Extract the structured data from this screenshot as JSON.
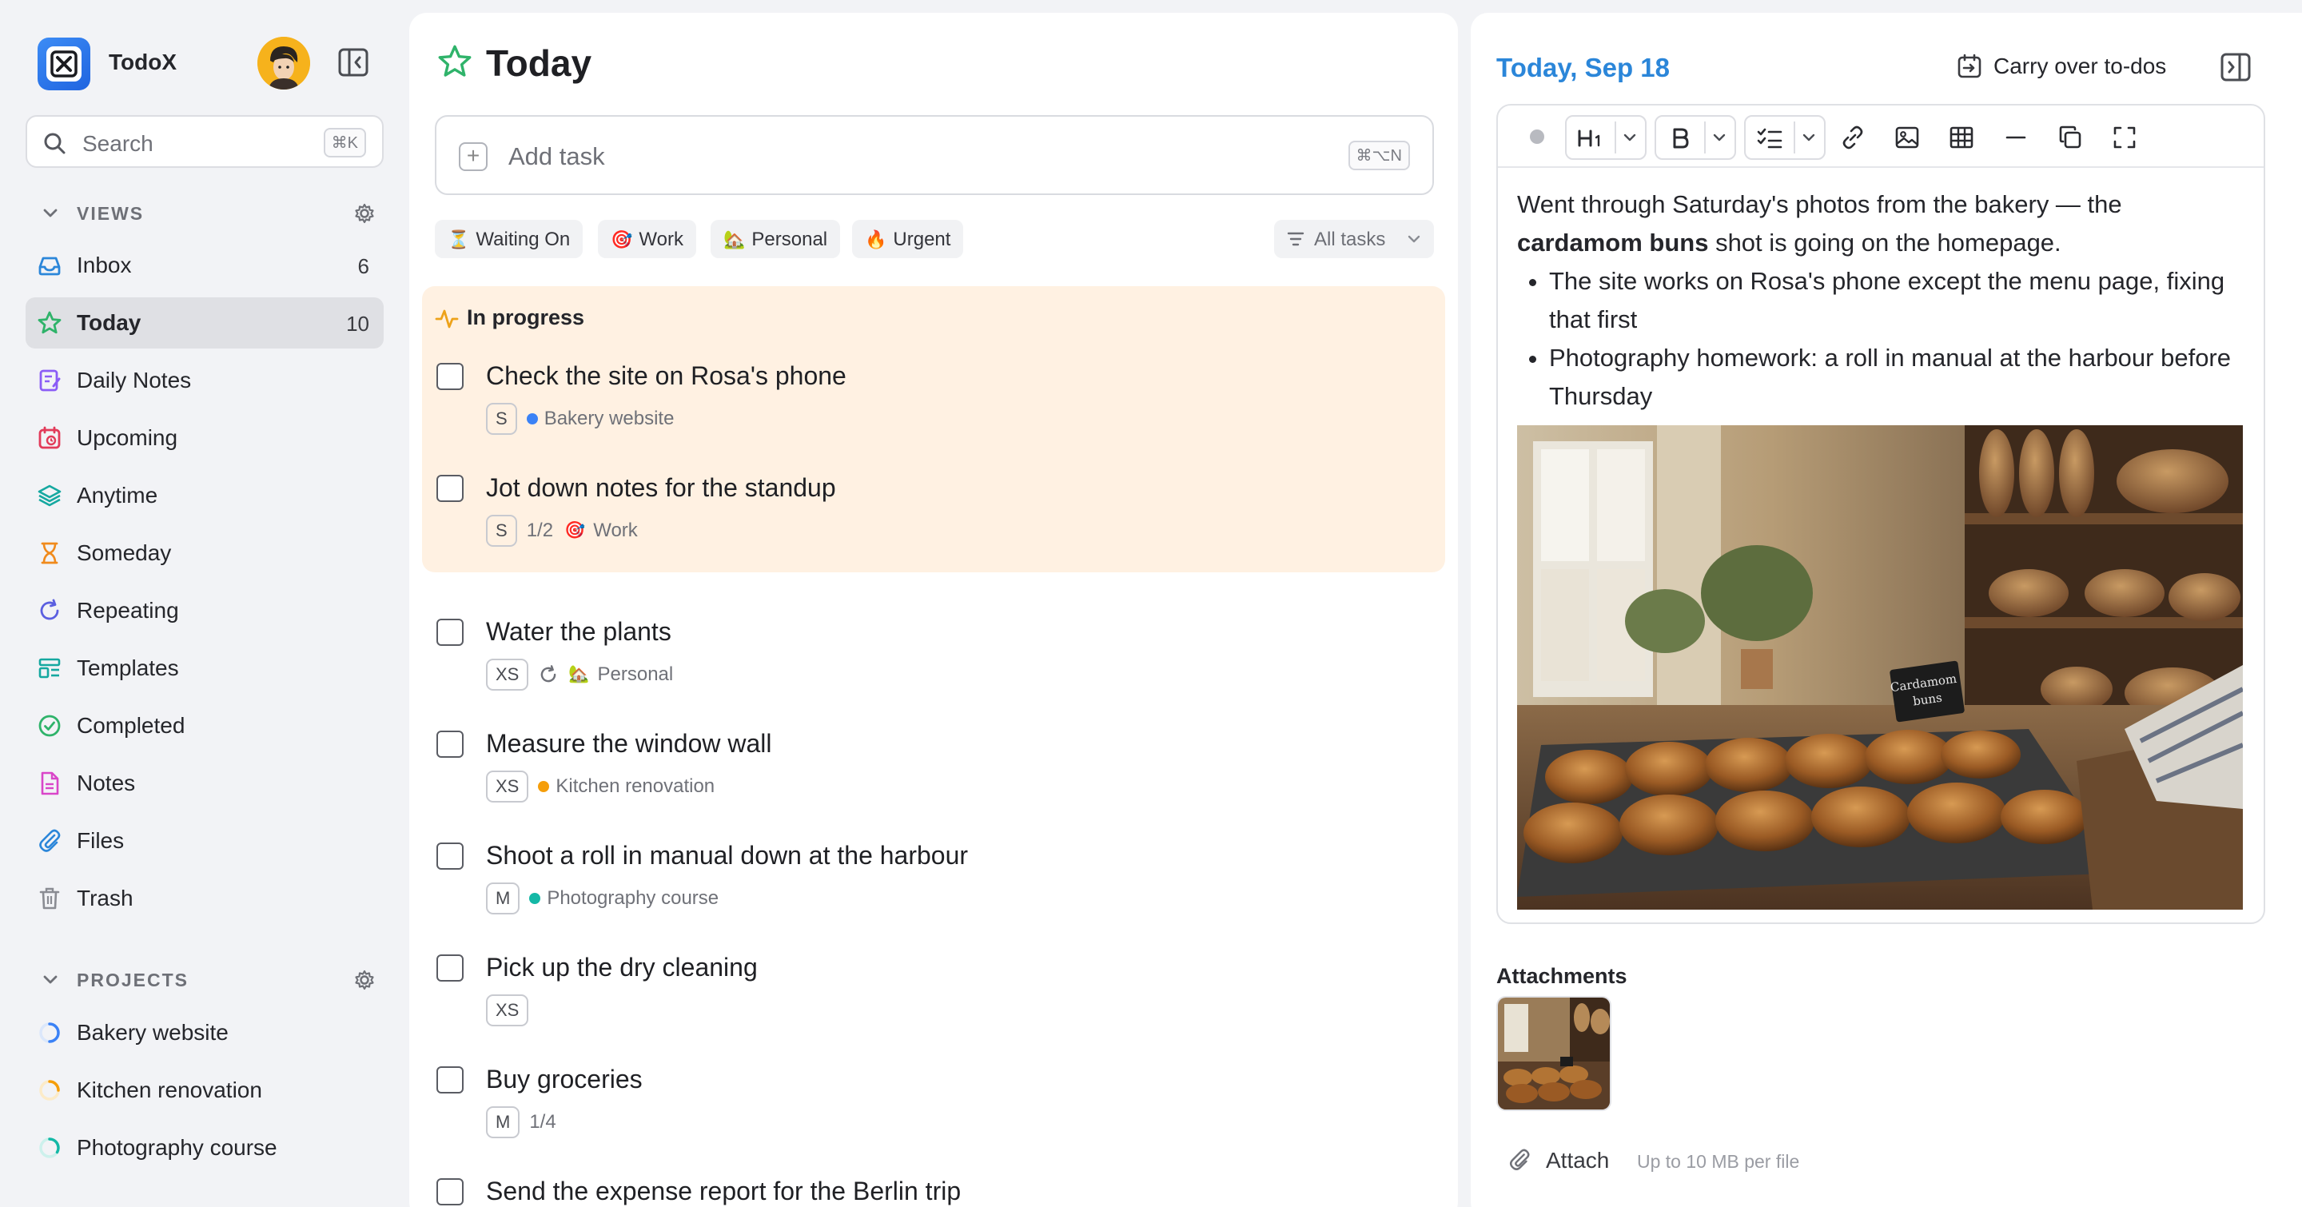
{
  "app": {
    "name": "TodoX"
  },
  "search": {
    "placeholder": "Search",
    "shortcut": "⌘K"
  },
  "views": {
    "heading": "VIEWS",
    "items": [
      {
        "label": "Inbox",
        "count": "6",
        "icon": "inbox-icon",
        "color": "#2b86d9"
      },
      {
        "label": "Today",
        "count": "10",
        "icon": "star-icon",
        "color": "#2fb36a"
      },
      {
        "label": "Daily Notes",
        "count": "",
        "icon": "daily-notes-icon",
        "color": "#8b5cf6"
      },
      {
        "label": "Upcoming",
        "count": "",
        "icon": "calendar-icon",
        "color": "#e23b5a"
      },
      {
        "label": "Anytime",
        "count": "",
        "icon": "layers-icon",
        "color": "#15a8a0"
      },
      {
        "label": "Someday",
        "count": "",
        "icon": "hourglass-icon",
        "color": "#f08a1c"
      },
      {
        "label": "Repeating",
        "count": "",
        "icon": "repeat-icon",
        "color": "#5b5fe0"
      },
      {
        "label": "Templates",
        "count": "",
        "icon": "template-icon",
        "color": "#15a8a0"
      },
      {
        "label": "Completed",
        "count": "",
        "icon": "check-circle-icon",
        "color": "#2fb36a"
      },
      {
        "label": "Notes",
        "count": "",
        "icon": "note-icon",
        "color": "#d946c9"
      },
      {
        "label": "Files",
        "count": "",
        "icon": "paperclip-icon",
        "color": "#2b86d9"
      },
      {
        "label": "Trash",
        "count": "",
        "icon": "trash-icon",
        "color": "#8a8c93"
      }
    ]
  },
  "projects": {
    "heading": "PROJECTS",
    "items": [
      {
        "label": "Bakery website",
        "color": "#3b82f6"
      },
      {
        "label": "Kitchen renovation",
        "color": "#f59e0b"
      },
      {
        "label": "Photography course",
        "color": "#14b8a6"
      }
    ]
  },
  "main": {
    "title": "Today",
    "add_task": {
      "placeholder": "Add task",
      "shortcut": "⌘⌥N"
    },
    "filters": [
      {
        "label": "Waiting On",
        "emoji": "⏳"
      },
      {
        "label": "Work",
        "emoji": "🎯"
      },
      {
        "label": "Personal",
        "emoji": "🏡"
      },
      {
        "label": "Urgent",
        "emoji": "🔥"
      }
    ],
    "all_tasks": "All tasks",
    "in_progress": {
      "heading": "In progress",
      "tasks": [
        {
          "title": "Check the site on Rosa's phone",
          "size": "S",
          "project": "Bakery website",
          "project_color": "#3b82f6"
        },
        {
          "title": "Jot down notes for the standup",
          "size": "S",
          "progress": "1/2",
          "tag": "Work",
          "tag_emoji": "🎯"
        }
      ]
    },
    "tasks": [
      {
        "title": "Water the plants",
        "size": "XS",
        "repeat_icon": "repeat-icon",
        "tag": "Personal",
        "tag_emoji": "🏡"
      },
      {
        "title": "Measure the window wall",
        "size": "XS",
        "project": "Kitchen renovation",
        "project_color": "#f59e0b"
      },
      {
        "title": "Shoot a roll in manual down at the harbour",
        "size": "M",
        "project": "Photography course",
        "project_color": "#14b8a6"
      },
      {
        "title": "Pick up the dry cleaning",
        "size": "XS"
      },
      {
        "title": "Buy groceries",
        "size": "M",
        "progress": "1/4"
      },
      {
        "title": "Send the expense report for the Berlin trip"
      }
    ]
  },
  "detail": {
    "date": "Today, Sep 18",
    "carry_over": "Carry over to-dos",
    "note": {
      "para_start": "Went through Saturday's photos from the bakery — the ",
      "para_bold": "cardamom buns",
      "para_end": " shot is going on the homepage.",
      "bullets": [
        "The site works on Rosa's phone except the menu page, fixing that first",
        "Photography homework: a roll in manual at the harbour before Thursday"
      ],
      "photo_sign": [
        "Cardamom",
        "buns"
      ]
    },
    "attachments": {
      "heading": "Attachments",
      "attach_label": "Attach",
      "hint": "Up to 10 MB per file"
    }
  }
}
